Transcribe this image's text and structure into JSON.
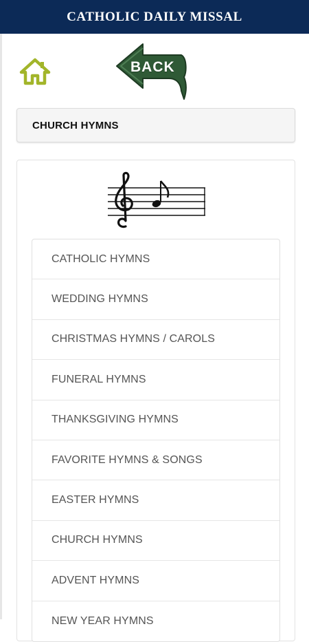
{
  "header": {
    "title": "CATHOLIC DAILY MISSAL"
  },
  "nav": {
    "home_icon": "home-icon",
    "back_label": "BACK",
    "back_icon": "back-arrow-icon",
    "colors": {
      "home": "#a2b52a",
      "back_arrow": "#2f5a36",
      "header_bg": "#0c2a57"
    }
  },
  "section": {
    "title": "CHURCH HYMNS",
    "icon": "music-staff-icon"
  },
  "hymn_list": {
    "items": [
      {
        "label": "CATHOLIC HYMNS"
      },
      {
        "label": "WEDDING HYMNS"
      },
      {
        "label": "CHRISTMAS HYMNS / CAROLS"
      },
      {
        "label": "FUNERAL HYMNS"
      },
      {
        "label": "THANKSGIVING HYMNS"
      },
      {
        "label": "FAVORITE HYMNS & SONGS"
      },
      {
        "label": "EASTER HYMNS"
      },
      {
        "label": "CHURCH HYMNS"
      },
      {
        "label": "ADVENT HYMNS"
      },
      {
        "label": "NEW YEAR HYMNS"
      }
    ]
  }
}
